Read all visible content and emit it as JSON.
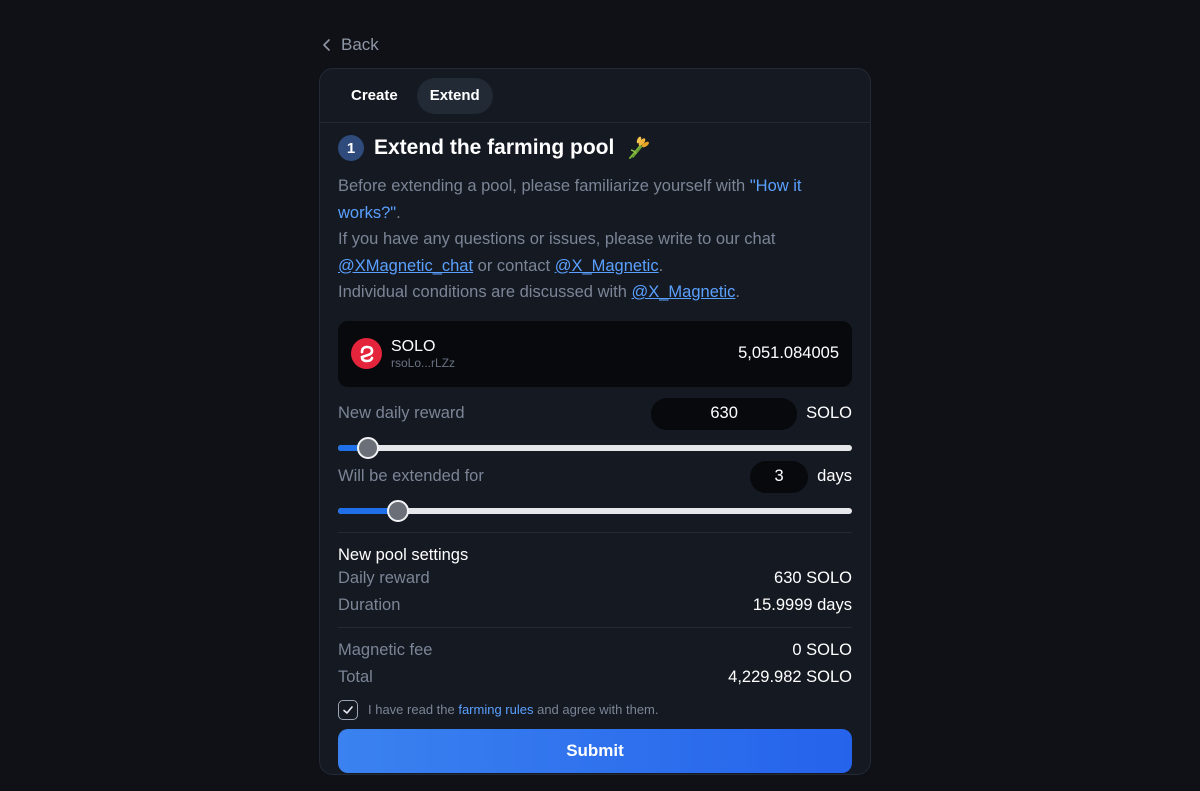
{
  "nav": {
    "back_label": "Back"
  },
  "tabs": [
    {
      "label": "Create",
      "active": false
    },
    {
      "label": "Extend",
      "active": true
    }
  ],
  "step": {
    "number": "1",
    "title": "Extend the farming pool",
    "emoji": "sheaf-of-rice-icon"
  },
  "description": {
    "line1_prefix": "Before extending a pool, please familiarize yourself with ",
    "how_link": "\"How it works?\"",
    "line1_suffix": ".",
    "line2_prefix": "If you have any questions or issues, please write to our chat ",
    "chat_link": "@XMagnetic_chat",
    "line2_mid": " or contact ",
    "contact_link": "@X_Magnetic",
    "line2_suffix": ".",
    "line3_prefix": "Individual conditions are discussed with ",
    "line3_link": "@X_Magnetic",
    "line3_suffix": "."
  },
  "token": {
    "name": "SOLO",
    "address": "rsoLo...rLZz",
    "balance": "5,051.084005",
    "icon": "solo-token-icon",
    "icon_color": "#e3243b"
  },
  "daily_reward": {
    "label": "New daily reward",
    "value": "630",
    "unit": "SOLO",
    "slider_fraction": 0.059
  },
  "extend_days": {
    "label": "Will be extended for",
    "value": "3",
    "unit": "days",
    "slider_fraction": 0.117
  },
  "new_settings": {
    "title": "New pool settings",
    "rows": [
      {
        "label": "Daily reward",
        "value": "630 SOLO"
      },
      {
        "label": "Duration",
        "value": "15.9999 days"
      }
    ]
  },
  "fees": {
    "rows": [
      {
        "label": "Magnetic fee",
        "value": "0 SOLO"
      },
      {
        "label": "Total",
        "value": "4,229.982 SOLO"
      }
    ]
  },
  "agreement": {
    "prefix": "I have read the ",
    "link": "farming rules",
    "suffix": " and agree with them.",
    "checked": true
  },
  "submit_label": "Submit",
  "colors": {
    "accent": "#3b82f0",
    "link": "#5aa0ff",
    "background": "#0f1116",
    "card": "#141922"
  }
}
